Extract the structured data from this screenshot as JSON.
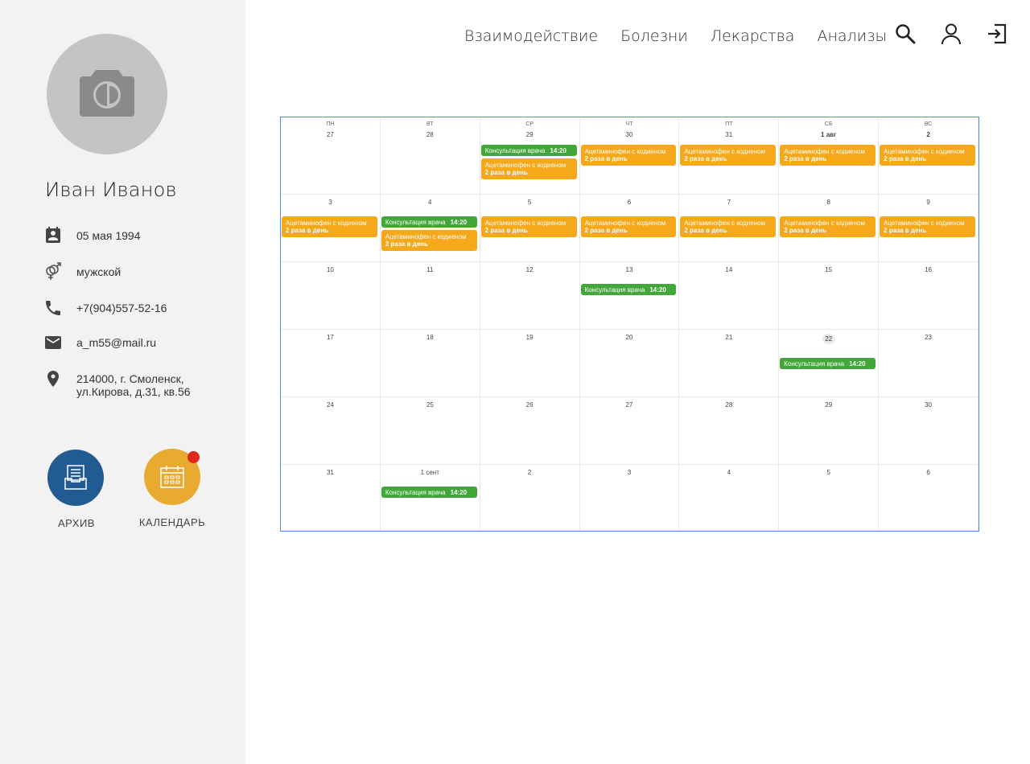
{
  "profile": {
    "name": "Иван Иванов",
    "birthdate": "05 мая 1994",
    "gender": "мужской",
    "phone": "+7(904)557-52-16",
    "email": "a_m55@mail.ru",
    "address_line1": "214000, г. Смоленск,",
    "address_line2": "ул.Кирова, д.31, кв.56",
    "icons": [
      "camera-icon",
      "calendar-person-icon",
      "gender-icon",
      "phone-icon",
      "email-icon",
      "location-pin-icon"
    ]
  },
  "actions": {
    "archive_label": "АРХИВ",
    "calendar_label": "КАЛЕНДАРЬ",
    "archive_color": "#215b91",
    "calendar_color": "#e8ab30",
    "notification_color": "#e1261c"
  },
  "nav": {
    "items": [
      "Взаимодействие",
      "Болезни",
      "Лекарства",
      "Анализы"
    ],
    "icons": [
      "search-icon",
      "user-icon",
      "logout-icon"
    ]
  },
  "calendar": {
    "weekdays": [
      "ПН",
      "ВТ",
      "СР",
      "ЧТ",
      "ПТ",
      "СБ",
      "ВС"
    ],
    "weeks": [
      [
        "27",
        "28",
        "29",
        "30",
        "31",
        "1 авг",
        "2"
      ],
      [
        "3",
        "4",
        "5",
        "6",
        "7",
        "8",
        "9"
      ],
      [
        "10",
        "11",
        "12",
        "13",
        "14",
        "15",
        "16"
      ],
      [
        "17",
        "18",
        "19",
        "20",
        "21",
        "22",
        "23"
      ],
      [
        "24",
        "25",
        "26",
        "27",
        "28",
        "29",
        "30"
      ],
      [
        "31",
        "1 сент",
        "2",
        "3",
        "4",
        "5",
        "6"
      ]
    ],
    "today": "22",
    "consult_title": "Консультация врача",
    "consult_time": "14:20",
    "med_title": "Ацетаминофен с кодиеном",
    "med_dose": "2 раза в день",
    "colors": {
      "consult": "#43a63a",
      "medication": "#f5a91a",
      "border": "#4a90e2"
    },
    "events": [
      {
        "week": 0,
        "day": 2,
        "type": "consult"
      },
      {
        "week": 0,
        "day": 2,
        "type": "med"
      },
      {
        "week": 0,
        "day": 3,
        "type": "med"
      },
      {
        "week": 0,
        "day": 4,
        "type": "med"
      },
      {
        "week": 0,
        "day": 5,
        "type": "med"
      },
      {
        "week": 0,
        "day": 6,
        "type": "med"
      },
      {
        "week": 1,
        "day": 0,
        "type": "med"
      },
      {
        "week": 1,
        "day": 1,
        "type": "consult"
      },
      {
        "week": 1,
        "day": 1,
        "type": "med"
      },
      {
        "week": 1,
        "day": 2,
        "type": "med"
      },
      {
        "week": 1,
        "day": 3,
        "type": "med"
      },
      {
        "week": 1,
        "day": 4,
        "type": "med"
      },
      {
        "week": 1,
        "day": 5,
        "type": "med"
      },
      {
        "week": 1,
        "day": 6,
        "type": "med"
      },
      {
        "week": 2,
        "day": 3,
        "type": "consult"
      },
      {
        "week": 3,
        "day": 5,
        "type": "consult"
      },
      {
        "week": 5,
        "day": 1,
        "type": "consult"
      }
    ]
  }
}
